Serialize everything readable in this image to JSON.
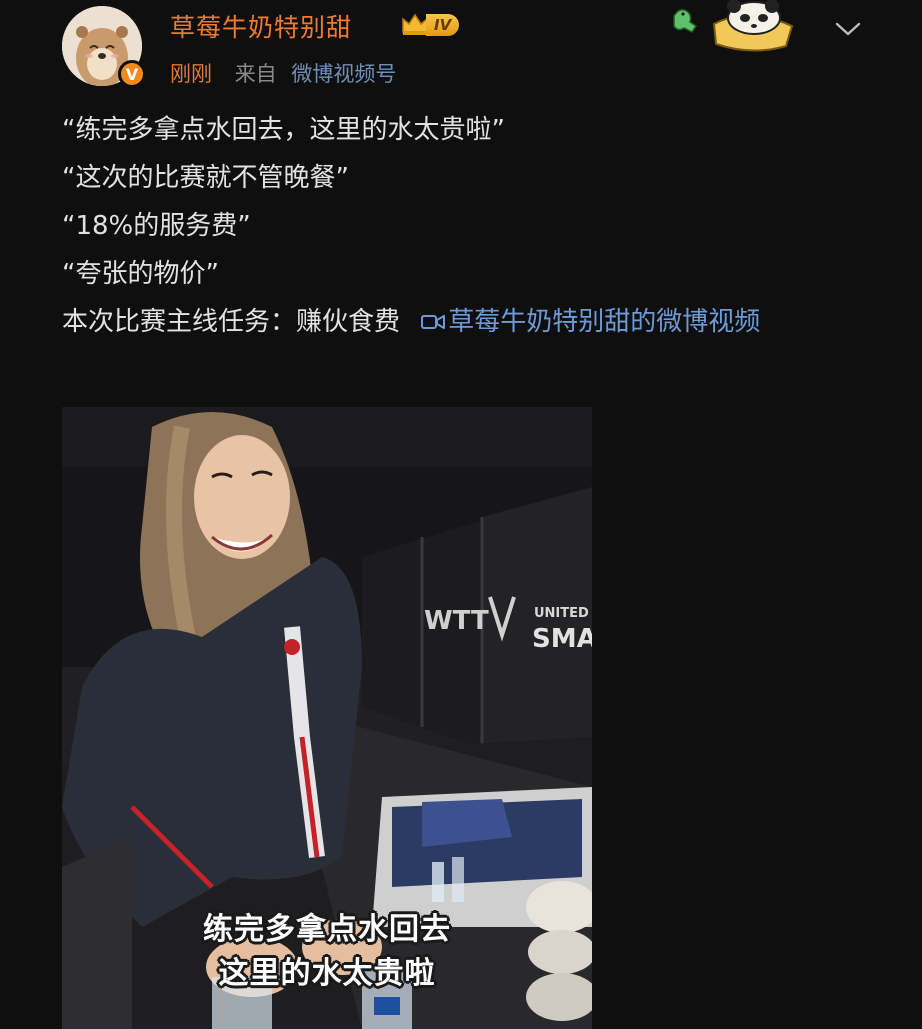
{
  "header": {
    "username": "草莓牛奶特别甜",
    "vip_level": "IV",
    "verified_mark": "V",
    "time": "刚刚",
    "from_label": "来自",
    "source": "微博视频号"
  },
  "content": {
    "lines": [
      "“练完多拿点水回去，这里的水太贵啦”",
      "“这次的比赛就不管晚餐”",
      "“18%的服务费”",
      "“夸张的物价”"
    ],
    "last_line_text": "本次比赛主线任务：赚伙食费",
    "video_link": "草莓牛奶特别甜的微博视频"
  },
  "video": {
    "caption_line1": "练完多拿点水回去",
    "caption_line2": "这里的水太贵啦",
    "banner_left": "WTT",
    "banner_right_top": "UNITED STATES",
    "banner_right_bottom": "SMASH"
  },
  "colors": {
    "background": "#0f0f10",
    "username": "#f07a2e",
    "link": "#6e9bd6",
    "time": "#e07a3a",
    "meta": "#8a8a8a"
  },
  "icons": [
    "verified-badge-icon",
    "vip-crown-icon",
    "sticker-decoration-icon",
    "chevron-down-icon",
    "video-link-icon"
  ]
}
